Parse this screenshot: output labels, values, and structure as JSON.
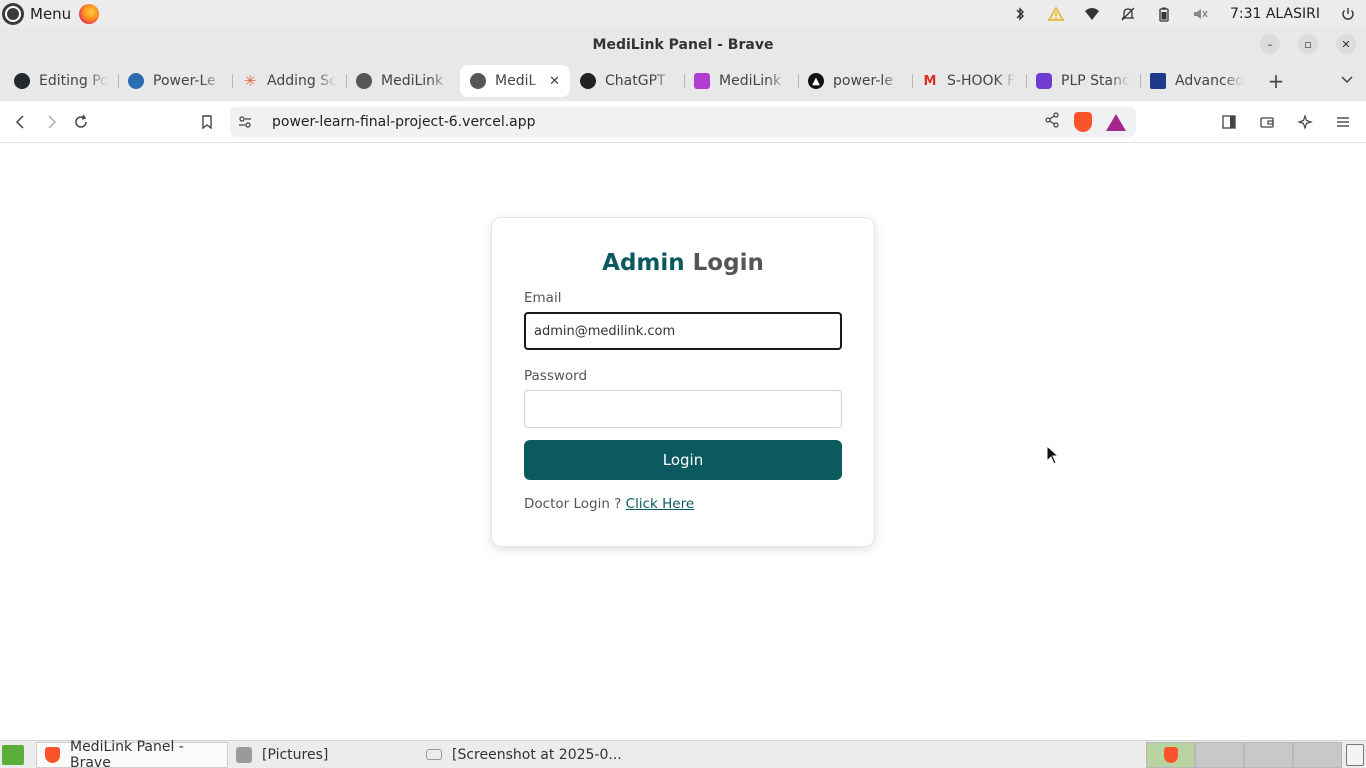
{
  "system_panel": {
    "menu_label": "Menu",
    "clock": "7:31 ALASIRI"
  },
  "window": {
    "title": "MediLink Panel - Brave"
  },
  "tabs": [
    {
      "label": "Editing Po",
      "favicon_color": "#24292f",
      "icon": "github-icon"
    },
    {
      "label": "Power-Le",
      "favicon_color": "#2b6cb0",
      "icon": "powerlearn-icon"
    },
    {
      "label": "Adding Sc",
      "favicon_color": "#e8663c",
      "icon": "claude-icon"
    },
    {
      "label": "MediLink",
      "favicon_color": "#555555",
      "icon": "globe-icon"
    },
    {
      "label": "MediL",
      "favicon_color": "#555555",
      "icon": "globe-icon",
      "active": true
    },
    {
      "label": "ChatGPT",
      "favicon_color": "#222222",
      "icon": "chatgpt-icon"
    },
    {
      "label": "MediLink",
      "favicon_color": "#b13ed1",
      "icon": "medilink-icon"
    },
    {
      "label": "power-le",
      "favicon_color": "#111111",
      "icon": "vercel-icon"
    },
    {
      "label": "S-HOOK F",
      "favicon_color": "#d93025",
      "icon": "gmail-icon"
    },
    {
      "label": "PLP Stanc",
      "favicon_color": "#6f3ccf",
      "icon": "plp-icon"
    },
    {
      "label": "Advanced",
      "favicon_color": "#1e3a8a",
      "icon": "bank-icon"
    }
  ],
  "toolbar": {
    "url": "power-learn-final-project-6.vercel.app"
  },
  "login": {
    "heading_accent": "Admin",
    "heading_rest": "Login",
    "email_label": "Email",
    "email_value": "admin@medilink.com",
    "password_label": "Password",
    "password_value": "",
    "login_button": "Login",
    "doctor_prompt": "Doctor Login ?",
    "doctor_link": "Click Here"
  },
  "taskbar": {
    "items": [
      {
        "label": "MediLink Panel - Brave"
      },
      {
        "label": "[Pictures]"
      },
      {
        "label": "[Screenshot at 2025-0..."
      }
    ]
  },
  "colors": {
    "brand_teal": "#0b5a60",
    "brave_orange": "#fb542b"
  }
}
